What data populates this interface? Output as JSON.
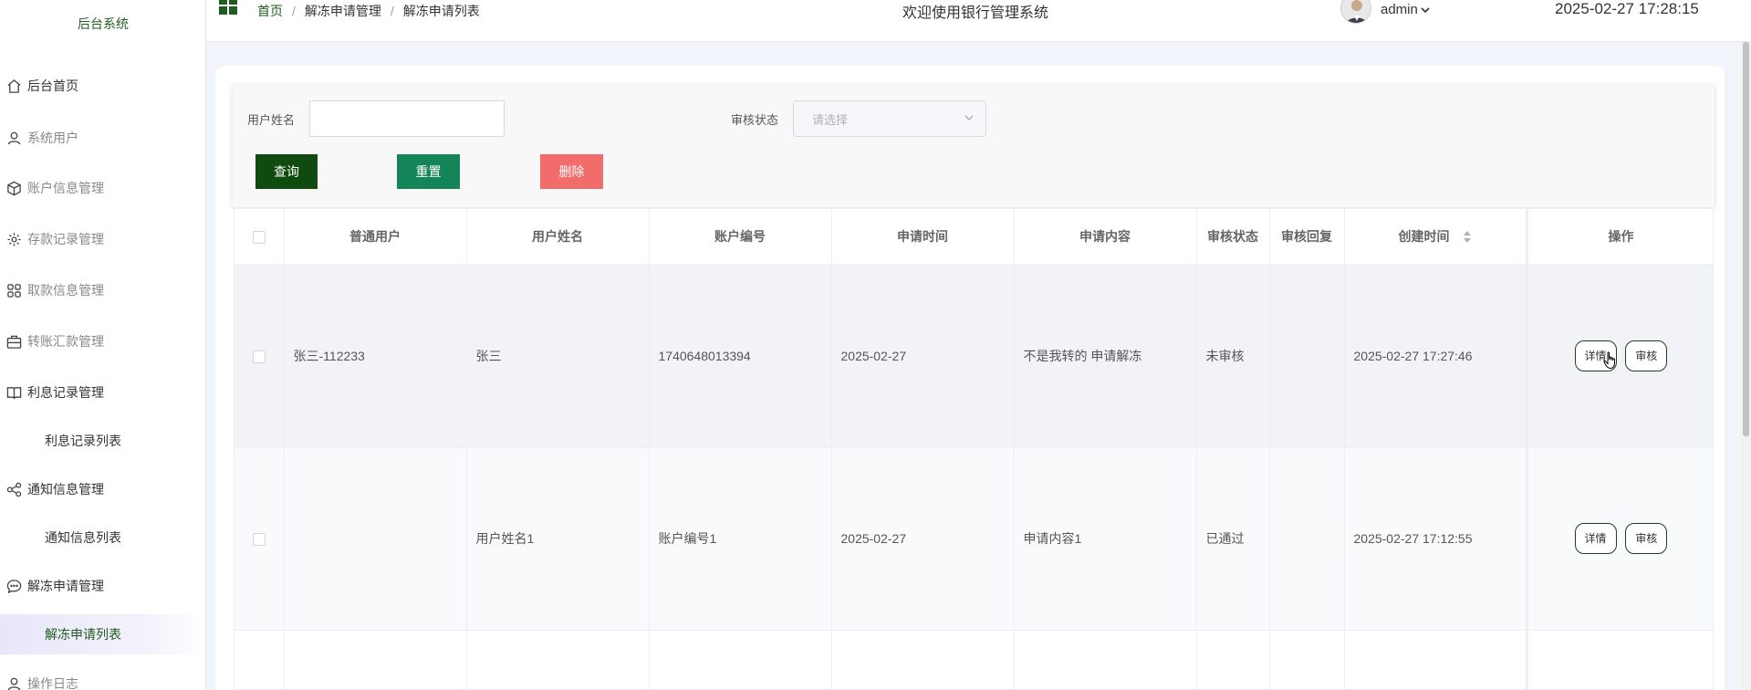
{
  "sidebar": {
    "brand": "后台系统",
    "items": [
      {
        "label": "后台首页",
        "icon": "home-icon"
      },
      {
        "label": "系统用户",
        "icon": "user-icon"
      },
      {
        "label": "账户信息管理",
        "icon": "cube-icon"
      },
      {
        "label": "存款记录管理",
        "icon": "gear-icon"
      },
      {
        "label": "取款信息管理",
        "icon": "grid-icon"
      },
      {
        "label": "转账汇款管理",
        "icon": "briefcase-icon"
      },
      {
        "label": "利息记录管理",
        "icon": "book-icon"
      },
      {
        "label": "利息记录列表"
      },
      {
        "label": "通知信息管理",
        "icon": "share-icon"
      },
      {
        "label": "通知信息列表"
      },
      {
        "label": "解冻申请管理",
        "icon": "chat-icon"
      },
      {
        "label": "解冻申请列表"
      },
      {
        "label": "操作日志",
        "icon": "user-icon"
      }
    ]
  },
  "header": {
    "breadcrumb": [
      "首页",
      "解冻申请管理",
      "解冻申请列表"
    ],
    "welcome": "欢迎使用银行管理系统",
    "username": "admin",
    "datetime": "2025-02-27 17:28:15"
  },
  "filters": {
    "username_label": "用户姓名",
    "username_value": "",
    "status_label": "审核状态",
    "status_placeholder": "请选择",
    "query": "查询",
    "reset": "重置",
    "delete": "删除"
  },
  "table": {
    "columns": [
      "普通用户",
      "用户姓名",
      "账户编号",
      "申请时间",
      "申请内容",
      "审核状态",
      "审核回复",
      "创建时间",
      "操作"
    ],
    "rows": [
      {
        "user": "张三-112233",
        "name": "张三",
        "account": "1740648013394",
        "apply_time": "2025-02-27",
        "content": "不是我转的 申请解冻",
        "status": "未审核",
        "reply": "",
        "created": "2025-02-27 17:27:46"
      },
      {
        "user": "",
        "name": "用户姓名1",
        "account": "账户编号1",
        "apply_time": "2025-02-27",
        "content": "申请内容1",
        "status": "已通过",
        "reply": "",
        "created": "2025-02-27 17:12:55"
      }
    ],
    "actions": {
      "detail": "详情",
      "review": "审核"
    }
  },
  "colors": {
    "brand_green": "#1f5c1f",
    "query_btn": "#0f4a0f",
    "reset_btn": "#138559",
    "delete_btn": "#f36c6c",
    "active_menu_bg": "#e9e6fa"
  }
}
